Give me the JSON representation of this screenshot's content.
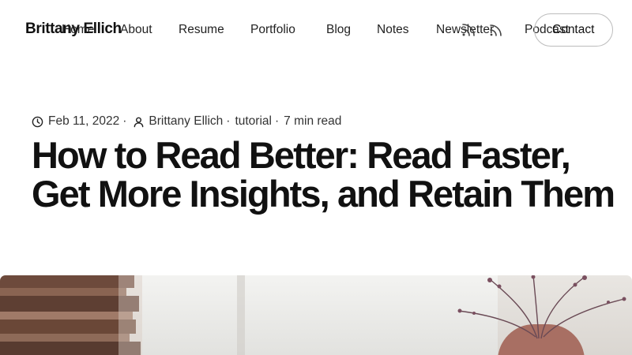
{
  "header": {
    "site_title": "Brittany Ellich",
    "nav": [
      {
        "label": "Home"
      },
      {
        "label": "About"
      },
      {
        "label": "Resume"
      },
      {
        "label": "Portfolio"
      },
      {
        "label": "Blog"
      },
      {
        "label": "Notes"
      },
      {
        "label": "Newsletter"
      },
      {
        "label": "Podcast"
      }
    ],
    "icons": [
      "rss-icon",
      "rss-icon"
    ],
    "contact_label": "Contact"
  },
  "post": {
    "date": "Feb 11, 2022",
    "author": "Brittany Ellich",
    "category": "tutorial",
    "read_time": "7 min read",
    "title": "How to Read Better: Read Faster, Get More Insights, and Retain Them"
  },
  "colors": {
    "text": "#111111",
    "meta_text": "#333333",
    "button_border": "#bcbcbc",
    "background": "#ffffff"
  }
}
